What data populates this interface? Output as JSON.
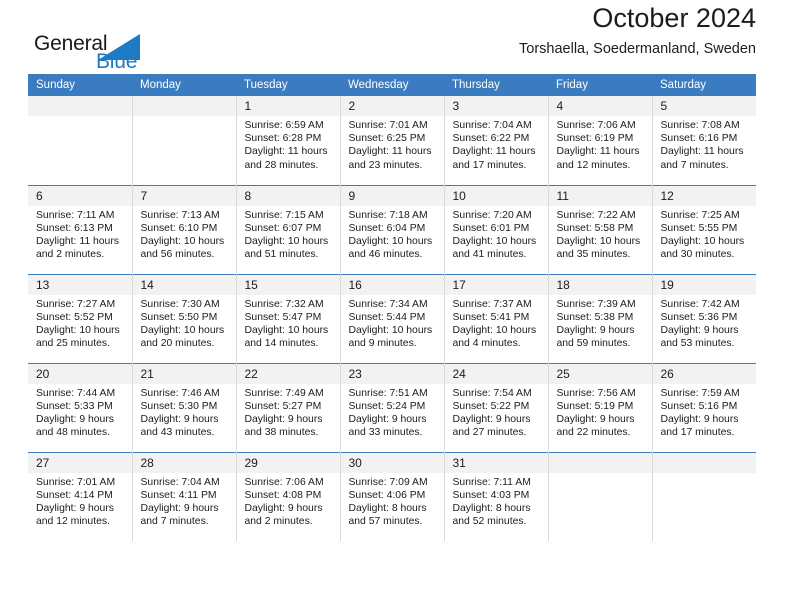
{
  "brand": {
    "name_part1": "General",
    "name_part2": "Blue",
    "accent_color": "#1f7ac4",
    "logo_icon": "triangle-icon"
  },
  "header": {
    "title": "October 2024",
    "subtitle": "Torshaella, Soedermanland, Sweden"
  },
  "calendar": {
    "header_bg": "#3b7cc0",
    "daynum_bg": "#f2f2f2",
    "weekday_headers": [
      "Sunday",
      "Monday",
      "Tuesday",
      "Wednesday",
      "Thursday",
      "Friday",
      "Saturday"
    ],
    "labels": {
      "sunrise": "Sunrise:",
      "sunset": "Sunset:",
      "daylight": "Daylight:"
    },
    "weeks": [
      [
        {
          "day": "",
          "sunrise": "",
          "sunset": "",
          "daylight": ""
        },
        {
          "day": "",
          "sunrise": "",
          "sunset": "",
          "daylight": ""
        },
        {
          "day": "1",
          "sunrise": "Sunrise: 6:59 AM",
          "sunset": "Sunset: 6:28 PM",
          "daylight": "Daylight: 11 hours and 28 minutes."
        },
        {
          "day": "2",
          "sunrise": "Sunrise: 7:01 AM",
          "sunset": "Sunset: 6:25 PM",
          "daylight": "Daylight: 11 hours and 23 minutes."
        },
        {
          "day": "3",
          "sunrise": "Sunrise: 7:04 AM",
          "sunset": "Sunset: 6:22 PM",
          "daylight": "Daylight: 11 hours and 17 minutes."
        },
        {
          "day": "4",
          "sunrise": "Sunrise: 7:06 AM",
          "sunset": "Sunset: 6:19 PM",
          "daylight": "Daylight: 11 hours and 12 minutes."
        },
        {
          "day": "5",
          "sunrise": "Sunrise: 7:08 AM",
          "sunset": "Sunset: 6:16 PM",
          "daylight": "Daylight: 11 hours and 7 minutes."
        }
      ],
      [
        {
          "day": "6",
          "sunrise": "Sunrise: 7:11 AM",
          "sunset": "Sunset: 6:13 PM",
          "daylight": "Daylight: 11 hours and 2 minutes."
        },
        {
          "day": "7",
          "sunrise": "Sunrise: 7:13 AM",
          "sunset": "Sunset: 6:10 PM",
          "daylight": "Daylight: 10 hours and 56 minutes."
        },
        {
          "day": "8",
          "sunrise": "Sunrise: 7:15 AM",
          "sunset": "Sunset: 6:07 PM",
          "daylight": "Daylight: 10 hours and 51 minutes."
        },
        {
          "day": "9",
          "sunrise": "Sunrise: 7:18 AM",
          "sunset": "Sunset: 6:04 PM",
          "daylight": "Daylight: 10 hours and 46 minutes."
        },
        {
          "day": "10",
          "sunrise": "Sunrise: 7:20 AM",
          "sunset": "Sunset: 6:01 PM",
          "daylight": "Daylight: 10 hours and 41 minutes."
        },
        {
          "day": "11",
          "sunrise": "Sunrise: 7:22 AM",
          "sunset": "Sunset: 5:58 PM",
          "daylight": "Daylight: 10 hours and 35 minutes."
        },
        {
          "day": "12",
          "sunrise": "Sunrise: 7:25 AM",
          "sunset": "Sunset: 5:55 PM",
          "daylight": "Daylight: 10 hours and 30 minutes."
        }
      ],
      [
        {
          "day": "13",
          "sunrise": "Sunrise: 7:27 AM",
          "sunset": "Sunset: 5:52 PM",
          "daylight": "Daylight: 10 hours and 25 minutes."
        },
        {
          "day": "14",
          "sunrise": "Sunrise: 7:30 AM",
          "sunset": "Sunset: 5:50 PM",
          "daylight": "Daylight: 10 hours and 20 minutes."
        },
        {
          "day": "15",
          "sunrise": "Sunrise: 7:32 AM",
          "sunset": "Sunset: 5:47 PM",
          "daylight": "Daylight: 10 hours and 14 minutes."
        },
        {
          "day": "16",
          "sunrise": "Sunrise: 7:34 AM",
          "sunset": "Sunset: 5:44 PM",
          "daylight": "Daylight: 10 hours and 9 minutes."
        },
        {
          "day": "17",
          "sunrise": "Sunrise: 7:37 AM",
          "sunset": "Sunset: 5:41 PM",
          "daylight": "Daylight: 10 hours and 4 minutes."
        },
        {
          "day": "18",
          "sunrise": "Sunrise: 7:39 AM",
          "sunset": "Sunset: 5:38 PM",
          "daylight": "Daylight: 9 hours and 59 minutes."
        },
        {
          "day": "19",
          "sunrise": "Sunrise: 7:42 AM",
          "sunset": "Sunset: 5:36 PM",
          "daylight": "Daylight: 9 hours and 53 minutes."
        }
      ],
      [
        {
          "day": "20",
          "sunrise": "Sunrise: 7:44 AM",
          "sunset": "Sunset: 5:33 PM",
          "daylight": "Daylight: 9 hours and 48 minutes."
        },
        {
          "day": "21",
          "sunrise": "Sunrise: 7:46 AM",
          "sunset": "Sunset: 5:30 PM",
          "daylight": "Daylight: 9 hours and 43 minutes."
        },
        {
          "day": "22",
          "sunrise": "Sunrise: 7:49 AM",
          "sunset": "Sunset: 5:27 PM",
          "daylight": "Daylight: 9 hours and 38 minutes."
        },
        {
          "day": "23",
          "sunrise": "Sunrise: 7:51 AM",
          "sunset": "Sunset: 5:24 PM",
          "daylight": "Daylight: 9 hours and 33 minutes."
        },
        {
          "day": "24",
          "sunrise": "Sunrise: 7:54 AM",
          "sunset": "Sunset: 5:22 PM",
          "daylight": "Daylight: 9 hours and 27 minutes."
        },
        {
          "day": "25",
          "sunrise": "Sunrise: 7:56 AM",
          "sunset": "Sunset: 5:19 PM",
          "daylight": "Daylight: 9 hours and 22 minutes."
        },
        {
          "day": "26",
          "sunrise": "Sunrise: 7:59 AM",
          "sunset": "Sunset: 5:16 PM",
          "daylight": "Daylight: 9 hours and 17 minutes."
        }
      ],
      [
        {
          "day": "27",
          "sunrise": "Sunrise: 7:01 AM",
          "sunset": "Sunset: 4:14 PM",
          "daylight": "Daylight: 9 hours and 12 minutes."
        },
        {
          "day": "28",
          "sunrise": "Sunrise: 7:04 AM",
          "sunset": "Sunset: 4:11 PM",
          "daylight": "Daylight: 9 hours and 7 minutes."
        },
        {
          "day": "29",
          "sunrise": "Sunrise: 7:06 AM",
          "sunset": "Sunset: 4:08 PM",
          "daylight": "Daylight: 9 hours and 2 minutes."
        },
        {
          "day": "30",
          "sunrise": "Sunrise: 7:09 AM",
          "sunset": "Sunset: 4:06 PM",
          "daylight": "Daylight: 8 hours and 57 minutes."
        },
        {
          "day": "31",
          "sunrise": "Sunrise: 7:11 AM",
          "sunset": "Sunset: 4:03 PM",
          "daylight": "Daylight: 8 hours and 52 minutes."
        },
        {
          "day": "",
          "sunrise": "",
          "sunset": "",
          "daylight": ""
        },
        {
          "day": "",
          "sunrise": "",
          "sunset": "",
          "daylight": ""
        }
      ]
    ]
  }
}
